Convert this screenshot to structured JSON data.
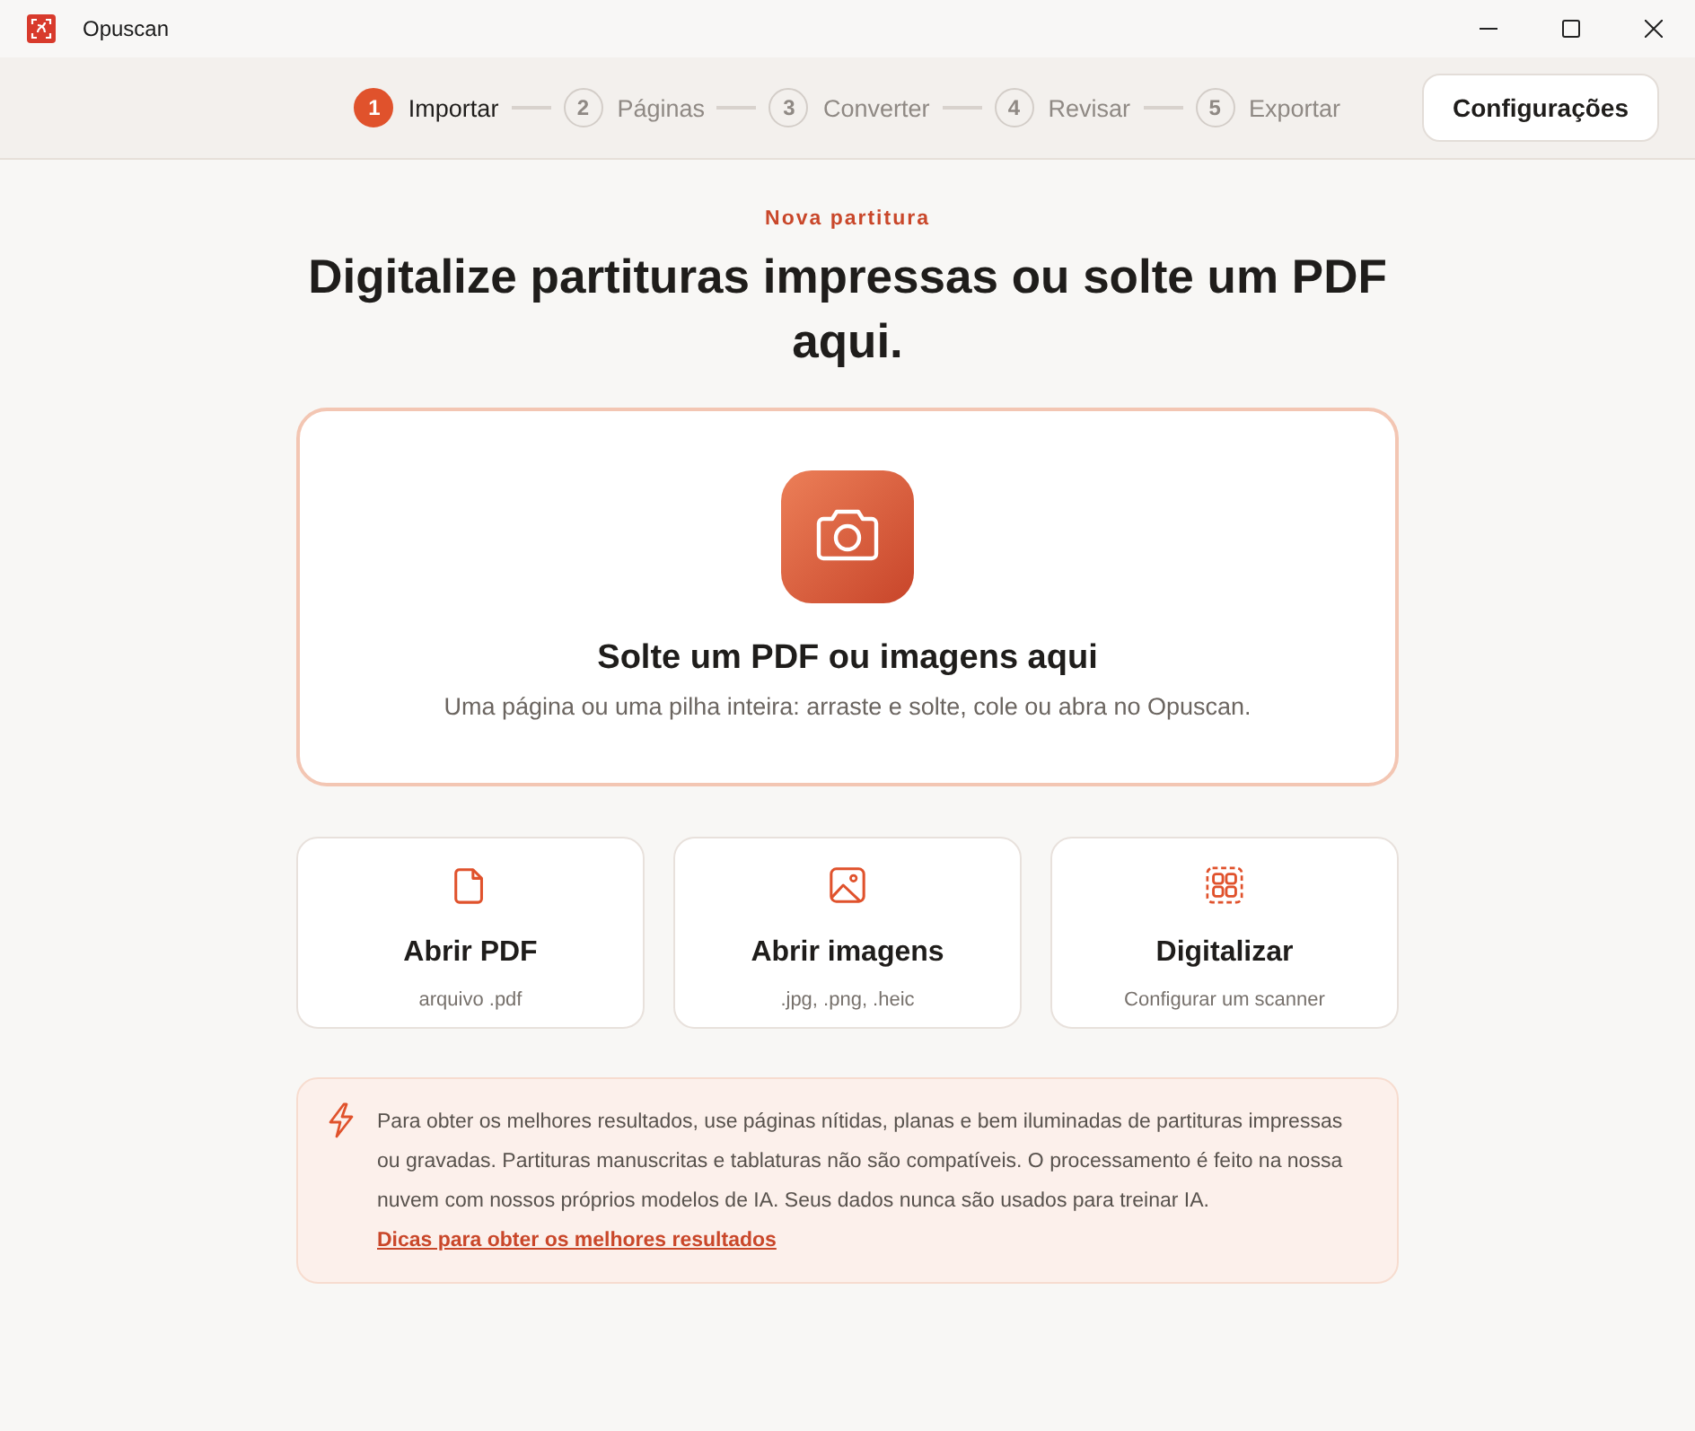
{
  "window": {
    "title": "Opuscan"
  },
  "steps": [
    {
      "number": "1",
      "label": "Importar",
      "selected": true
    },
    {
      "number": "2",
      "label": "Páginas",
      "selected": false
    },
    {
      "number": "3",
      "label": "Converter",
      "selected": false
    },
    {
      "number": "4",
      "label": "Revisar",
      "selected": false
    },
    {
      "number": "5",
      "label": "Exportar",
      "selected": false
    }
  ],
  "settings_button": "Configurações",
  "eyebrow": "Nova partitura",
  "heading": "Digitalize partituras impressas ou solte um PDF aqui.",
  "drop_zone": {
    "title": "Solte um PDF ou imagens aqui",
    "subtitle": "Uma página ou uma pilha inteira: arraste e solte, cole ou abra no Opuscan."
  },
  "options": [
    {
      "kind": "pdf",
      "title": "Abrir PDF",
      "subtitle": "arquivo .pdf"
    },
    {
      "kind": "images",
      "title": "Abrir imagens",
      "subtitle": ".jpg, .png, .heic"
    },
    {
      "kind": "scan",
      "title": "Digitalizar",
      "subtitle": "Configurar um scanner"
    }
  ],
  "tip": {
    "text": "Para obter os melhores resultados, use páginas nítidas, planas e bem iluminadas de partituras impressas ou gravadas. Partituras manuscritas e tablaturas não são compatíveis. O processamento é feito na nossa nuvem com nossos próprios modelos de IA. Seus dados nunca são usados para treinar IA.",
    "link": "Dicas para obter os melhores resultados"
  }
}
